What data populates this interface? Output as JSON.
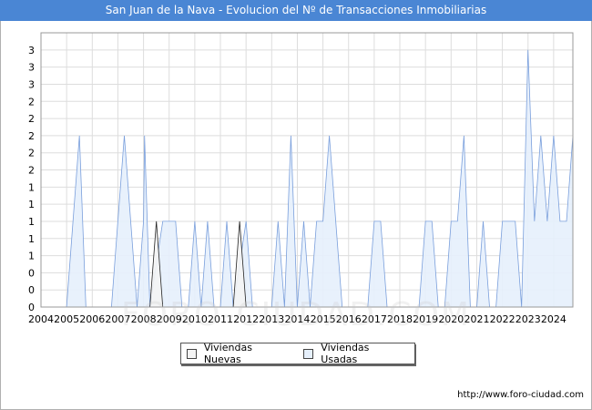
{
  "title": "San Juan de la Nava - Evolucion del Nº de Transacciones Inmobiliarias",
  "watermark": "FORO-CIUDAD.COM",
  "credit": "http://www.foro-ciudad.com",
  "colors": {
    "title_bg": "#4a86d4",
    "nuevas_fill": "#f4f4f4",
    "nuevas_line": "#222222",
    "usadas_fill": "#e6f0fc",
    "usadas_line": "#7a9fdc",
    "grid": "#dddddd"
  },
  "chart_data": {
    "type": "area",
    "x_ticks": [
      "2004",
      "2005",
      "2006",
      "2007",
      "2008",
      "2009",
      "2010",
      "2011",
      "2012",
      "2013",
      "2014",
      "2015",
      "2016",
      "2017",
      "2018",
      "2019",
      "2020",
      "2021",
      "2022",
      "2023",
      "2024"
    ],
    "y_ticks": [
      "0",
      "0",
      "0",
      "1",
      "1",
      "1",
      "1",
      "1",
      "2",
      "2",
      "2",
      "2",
      "2",
      "3",
      "3",
      "3"
    ],
    "ylim": [
      0,
      3.2
    ],
    "xlim": [
      2004,
      2024.75
    ],
    "grid": true,
    "legend_position": "bottom",
    "series": [
      {
        "name": "Viviendas Nuevas",
        "points": [
          [
            2008.25,
            0
          ],
          [
            2008.5,
            1
          ],
          [
            2008.75,
            0
          ],
          [
            2011.5,
            0
          ],
          [
            2011.75,
            1
          ],
          [
            2012.0,
            0
          ]
        ]
      },
      {
        "name": "Viviendas Usadas",
        "points": [
          [
            2005,
            0
          ],
          [
            2005.5,
            2
          ],
          [
            2005.75,
            0
          ],
          [
            2006.75,
            0
          ],
          [
            2007.0,
            1
          ],
          [
            2007.25,
            2
          ],
          [
            2007.75,
            0
          ],
          [
            2008.0,
            1
          ],
          [
            2008.04,
            2
          ],
          [
            2008.25,
            0
          ],
          [
            2008.75,
            1
          ],
          [
            2009.25,
            1
          ],
          [
            2009.5,
            0
          ],
          [
            2009.75,
            0
          ],
          [
            2010.0,
            1
          ],
          [
            2010.25,
            0
          ],
          [
            2010.5,
            1
          ],
          [
            2010.75,
            0
          ],
          [
            2011.0,
            0
          ],
          [
            2011.25,
            1
          ],
          [
            2011.5,
            0
          ],
          [
            2012.0,
            1
          ],
          [
            2012.25,
            0
          ],
          [
            2013.0,
            0
          ],
          [
            2013.25,
            1
          ],
          [
            2013.5,
            0
          ],
          [
            2013.75,
            2
          ],
          [
            2014.0,
            0
          ],
          [
            2014.25,
            1
          ],
          [
            2014.5,
            0
          ],
          [
            2014.75,
            1
          ],
          [
            2015.0,
            1
          ],
          [
            2015.25,
            2
          ],
          [
            2015.75,
            0
          ],
          [
            2016.75,
            0
          ],
          [
            2017.0,
            1
          ],
          [
            2017.25,
            1
          ],
          [
            2017.5,
            0
          ],
          [
            2018.75,
            0
          ],
          [
            2019.0,
            1
          ],
          [
            2019.25,
            1
          ],
          [
            2019.5,
            0
          ],
          [
            2019.75,
            0
          ],
          [
            2020.0,
            1
          ],
          [
            2020.25,
            1
          ],
          [
            2020.5,
            2
          ],
          [
            2020.75,
            0
          ],
          [
            2021.0,
            0
          ],
          [
            2021.25,
            1
          ],
          [
            2021.5,
            0
          ],
          [
            2021.75,
            0
          ],
          [
            2022.0,
            1
          ],
          [
            2022.5,
            1
          ],
          [
            2022.75,
            0
          ],
          [
            2023.0,
            3
          ],
          [
            2023.25,
            1
          ],
          [
            2023.5,
            2
          ],
          [
            2023.75,
            1
          ],
          [
            2024.0,
            2
          ],
          [
            2024.25,
            1
          ],
          [
            2024.5,
            1
          ],
          [
            2024.75,
            2
          ]
        ]
      }
    ]
  }
}
